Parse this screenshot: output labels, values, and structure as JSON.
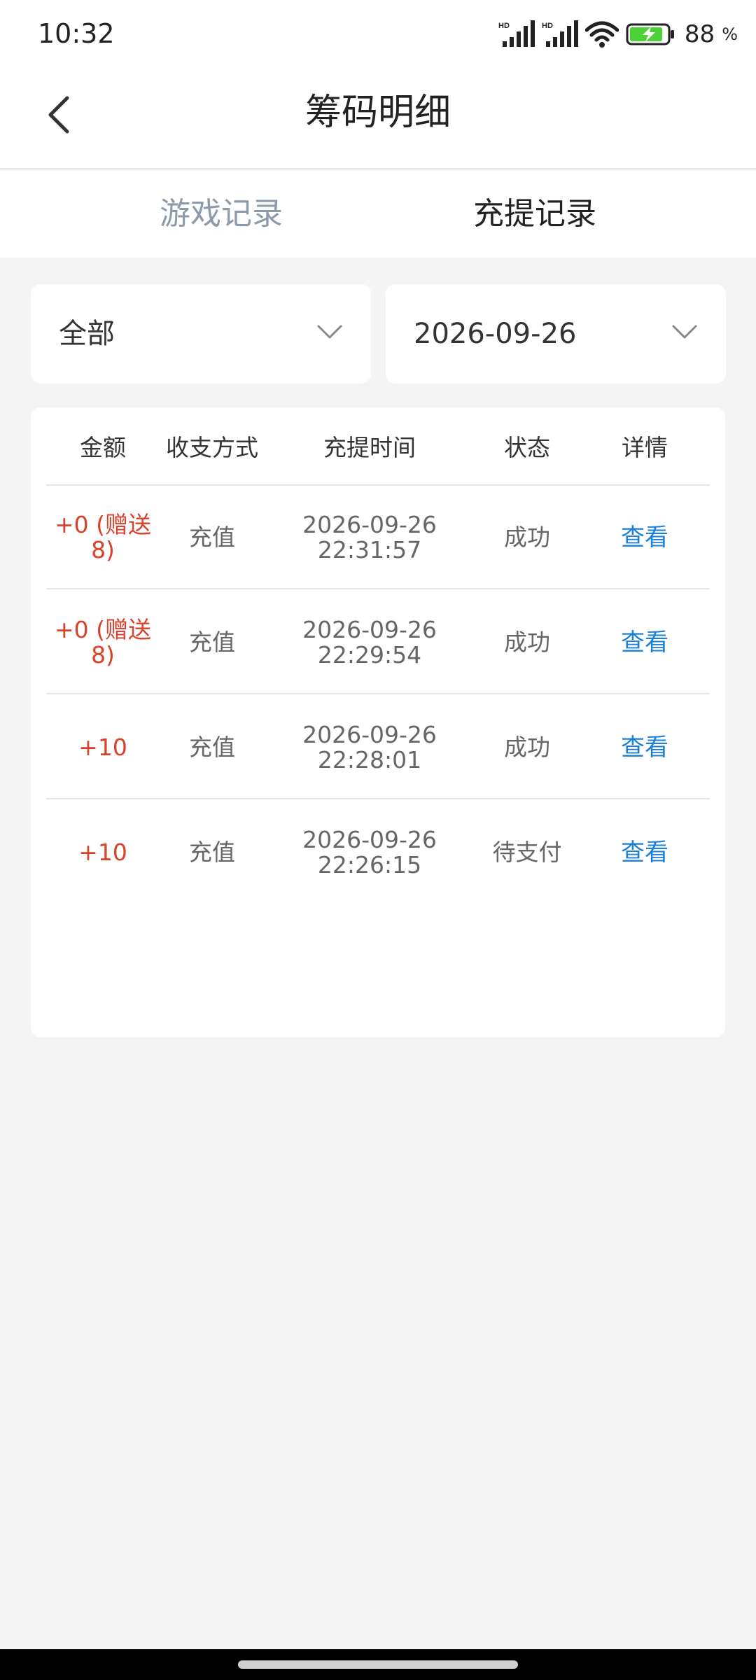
{
  "status_bar": {
    "time": "10:32",
    "signal_label_1": "HD",
    "signal_label_2": "HD",
    "battery_value": "88",
    "battery_unit": "%",
    "battery_level": 0.88
  },
  "header": {
    "title": "筹码明细"
  },
  "tabs": [
    {
      "label": "游戏记录",
      "active": false
    },
    {
      "label": "充提记录",
      "active": true
    }
  ],
  "filters": {
    "type_value": "全部",
    "date_value": "2026-09-26"
  },
  "table": {
    "columns": [
      "金额",
      "收支方式",
      "充提时间",
      "状态",
      "详情"
    ],
    "rows": [
      {
        "amount": "+0 (赠送8)",
        "type": "充值",
        "date": "2026-09-26",
        "time": "22:31:57",
        "status": "成功",
        "detail": "查看"
      },
      {
        "amount": "+0 (赠送8)",
        "type": "充值",
        "date": "2026-09-26",
        "time": "22:29:54",
        "status": "成功",
        "detail": "查看"
      },
      {
        "amount": "+10",
        "type": "充值",
        "date": "2026-09-26",
        "time": "22:28:01",
        "status": "成功",
        "detail": "查看"
      },
      {
        "amount": "+10",
        "type": "充值",
        "date": "2026-09-26",
        "time": "22:26:15",
        "status": "待支付",
        "detail": "查看"
      }
    ]
  },
  "colors": {
    "amount": "#d9412b",
    "link": "#1a7fd6",
    "tab_inactive": "#8e9aaa",
    "battery": "#4cd137"
  },
  "icons": {
    "back": "chevron-left-icon",
    "dropdown": "chevron-down-icon",
    "signal": "cellular-signal-icon",
    "wifi": "wifi-icon",
    "battery": "battery-charging-icon"
  }
}
